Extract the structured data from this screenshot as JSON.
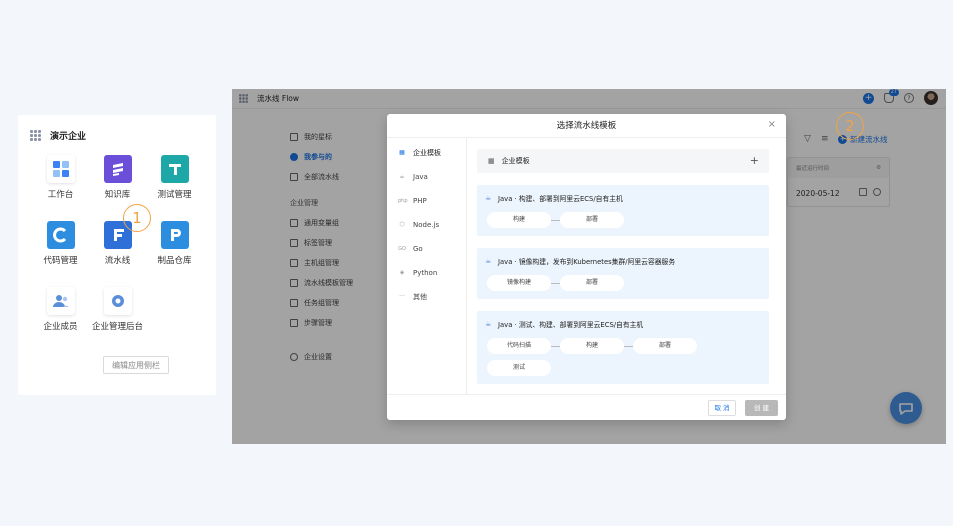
{
  "launcher": {
    "title": "演示企业",
    "apps": [
      {
        "label": "工作台",
        "icon": "workbench-icon",
        "color": "#3b82f6"
      },
      {
        "label": "知识库",
        "icon": "knowledge-base-icon",
        "color": "#6b4fd8"
      },
      {
        "label": "测试管理",
        "icon": "test-management-icon",
        "color": "#1ea7a7"
      },
      {
        "label": "代码管理",
        "icon": "code-management-icon",
        "color": "#2d8ee0"
      },
      {
        "label": "流水线",
        "icon": "pipeline-icon",
        "color": "#2f6fd8"
      },
      {
        "label": "制品仓库",
        "icon": "artifact-repo-icon",
        "color": "#2d8ee0"
      },
      {
        "label": "企业成员",
        "icon": "members-icon",
        "color": "#5b8ed8"
      },
      {
        "label": "企业管理后台",
        "icon": "admin-console-icon",
        "color": "#5b8ed8"
      }
    ],
    "edit_label": "编辑应用侧栏"
  },
  "markers": {
    "step1": "1",
    "step2": "2"
  },
  "app": {
    "name": "流水线 Flow",
    "notification_count": "27",
    "help": "?"
  },
  "nav": {
    "items": [
      "我的星标",
      "我参与的",
      "全部流水线"
    ],
    "group": "企业管理",
    "manage_items": [
      "通用变量组",
      "标签管理",
      "主机组管理",
      "流水线模板管理",
      "任务组管理",
      "步骤管理"
    ],
    "settings": "企业设置"
  },
  "list": {
    "new_label": "新建流水线",
    "col_last_run": "最近运行时间",
    "last_run_value": "2020-05-12"
  },
  "modal": {
    "title": "选择流水线模板",
    "close": "×",
    "categories": [
      {
        "label": "企业模板",
        "icon": "enterprise-template-icon"
      },
      {
        "label": "Java",
        "icon": "java-icon"
      },
      {
        "label": "PHP",
        "icon": "php-icon"
      },
      {
        "label": "Node.js",
        "icon": "nodejs-icon"
      },
      {
        "label": "Go",
        "icon": "go-icon"
      },
      {
        "label": "Python",
        "icon": "python-icon"
      },
      {
        "label": "其他",
        "icon": "more-icon"
      }
    ],
    "section_title": "企业模板",
    "templates": [
      {
        "title": "Java · 构建、部署到阿里云ECS/自有主机",
        "stages": [
          "构建",
          "部署"
        ]
      },
      {
        "title": "Java · 镜像构建，发布到Kubernetes集群/阿里云容器服务",
        "stages": [
          "镜像构建",
          "部署"
        ]
      },
      {
        "title": "Java · 测试、构建、部署到阿里云ECS/自有主机",
        "stages": [
          "代码扫描",
          "构建",
          "部署"
        ],
        "parallel": "测试"
      }
    ],
    "cancel_label": "取 消",
    "create_label": "创 建"
  },
  "colors": {
    "accent": "#1b74e4",
    "marker": "#f0a347"
  }
}
